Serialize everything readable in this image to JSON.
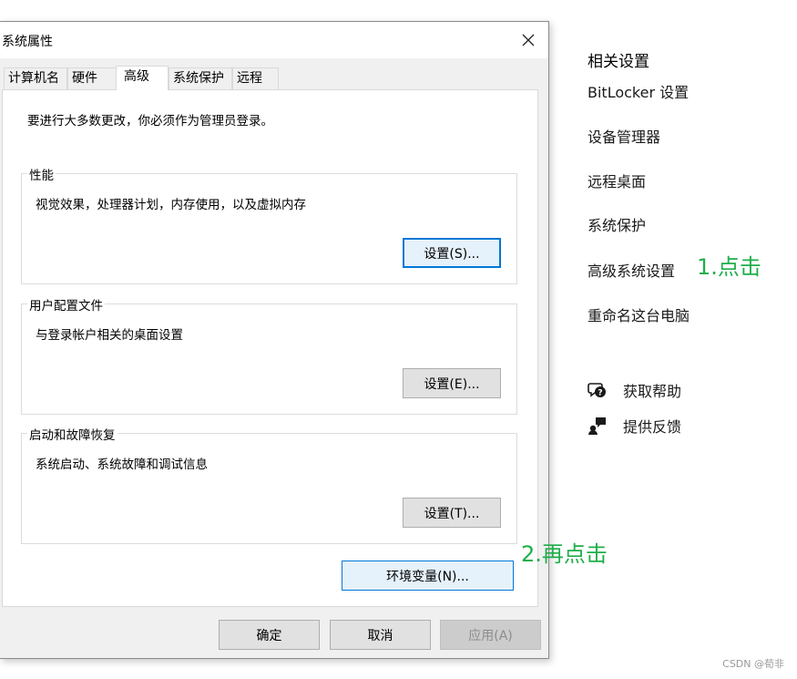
{
  "dialog": {
    "title": "系统属性",
    "tabs": [
      {
        "label": "计算机名"
      },
      {
        "label": "硬件"
      },
      {
        "label": "高级"
      },
      {
        "label": "系统保护"
      },
      {
        "label": "远程"
      }
    ],
    "active_tab": "高级",
    "intro": "要进行大多数更改，你必须作为管理员登录。",
    "groups": {
      "performance": {
        "title": "性能",
        "desc": "视觉效果，处理器计划，内存使用，以及虚拟内存",
        "button": "设置(S)..."
      },
      "profile": {
        "title": "用户配置文件",
        "desc": "与登录帐户相关的桌面设置",
        "button": "设置(E)..."
      },
      "startup": {
        "title": "启动和故障恢复",
        "desc": "系统启动、系统故障和调试信息",
        "button": "设置(T)..."
      }
    },
    "env_button": "环境变量(N)...",
    "footer": {
      "ok": "确定",
      "cancel": "取消",
      "apply": "应用(A)"
    }
  },
  "annotations": {
    "step1": "1.点击",
    "step2": "2.再点击",
    "color": "#1fae4a"
  },
  "right_panel": {
    "heading": "相关设置",
    "links": [
      {
        "label": "BitLocker 设置"
      },
      {
        "label": "设备管理器"
      },
      {
        "label": "远程桌面"
      },
      {
        "label": "系统保护"
      },
      {
        "label": "高级系统设置"
      },
      {
        "label": "重命名这台电脑"
      }
    ],
    "help": [
      {
        "label": "获取帮助",
        "icon": "help-chat-icon"
      },
      {
        "label": "提供反馈",
        "icon": "feedback-icon"
      }
    ]
  },
  "watermark": "CSDN @荀非"
}
